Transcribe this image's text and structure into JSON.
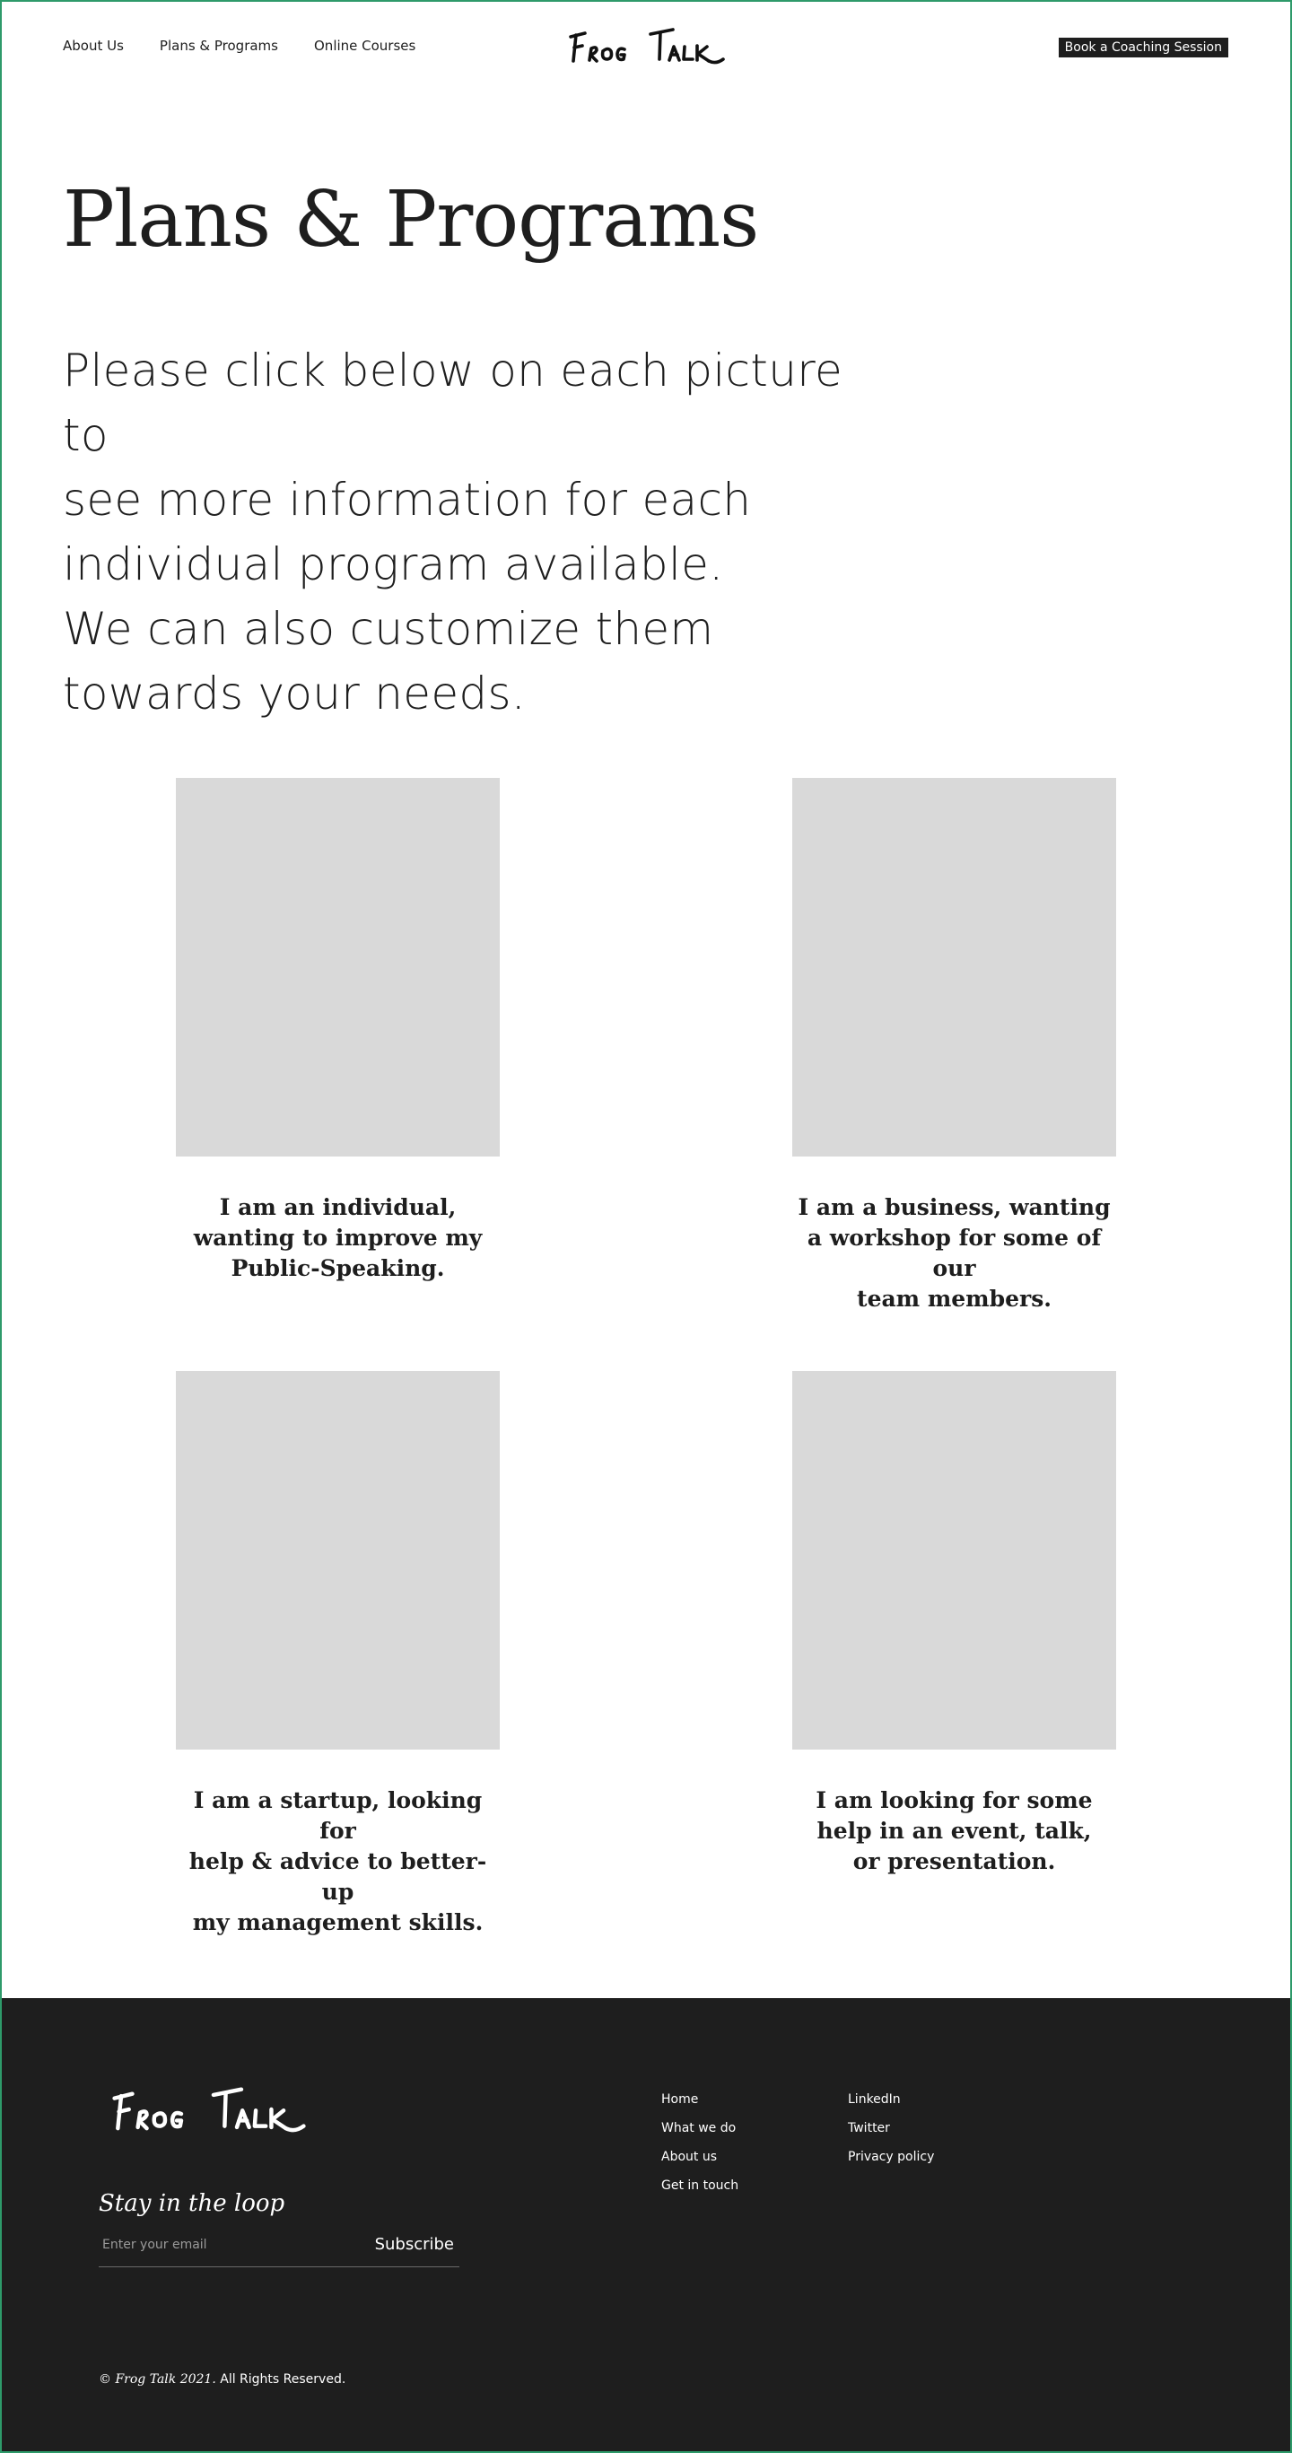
{
  "header": {
    "nav": [
      "About Us",
      "Plans & Programs",
      "Online Courses"
    ],
    "logo_text": "Frog Talk",
    "cta_label": "Book a Coaching Session"
  },
  "hero": {
    "title": "Plans & Programs",
    "intro_lines": [
      "Please click below on each picture to",
      "see more information for each",
      "individual program available.",
      "We can also customize them",
      "towards your needs."
    ]
  },
  "programs": [
    {
      "caption_lines": [
        "I am an individual,",
        "wanting to improve my",
        "Public-Speaking."
      ]
    },
    {
      "caption_lines": [
        "I am a business, wanting",
        "a workshop for some of our",
        "team members."
      ]
    },
    {
      "caption_lines": [
        "I am a startup, looking for",
        "help & advice to better-up",
        "my management skills."
      ]
    },
    {
      "caption_lines": [
        "I am looking for some",
        "help in an event, talk,",
        "or presentation."
      ]
    }
  ],
  "footer": {
    "logo_text": "Frog Talk",
    "newsletter_title": "Stay in the loop",
    "email_placeholder": "Enter your email",
    "subscribe_label": "Subscribe",
    "links_col1": [
      "Home",
      "What we do",
      "About us",
      "Get in touch"
    ],
    "links_col2": [
      "LinkedIn",
      "Twitter",
      "Privacy policy"
    ],
    "copyright_brand": "© Frog Talk 2021.",
    "copyright_rest": " All Rights Reserved."
  },
  "colors": {
    "dark": "#1e1e1e",
    "image_placeholder": "#d9d9d9",
    "frame_border": "#2e9a6a"
  }
}
